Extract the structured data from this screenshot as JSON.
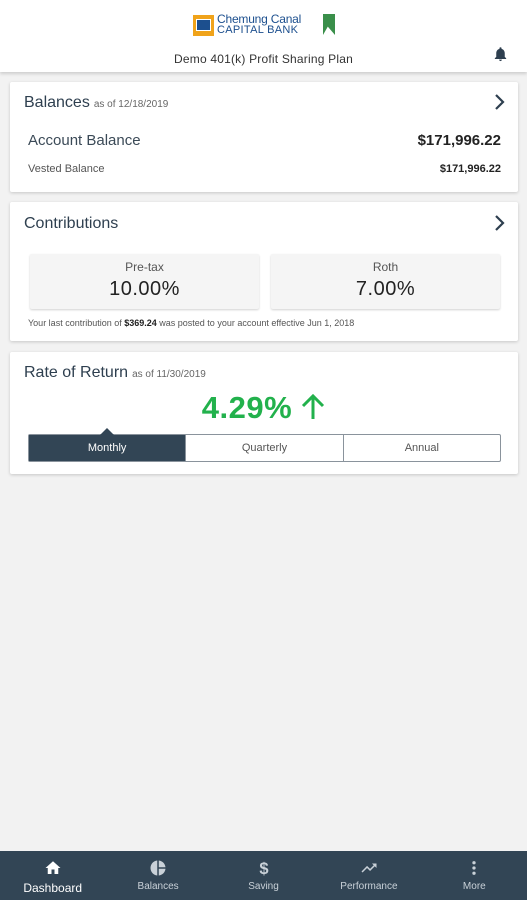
{
  "header": {
    "logo_line1": "Chemung Canal",
    "logo_line2": "CAPITAL BANK",
    "plan_name": "Demo 401(k) Profit Sharing Plan"
  },
  "balances": {
    "title": "Balances",
    "as_of": "as of 12/18/2019",
    "account_label": "Account Balance",
    "account_value": "$171,996.22",
    "vested_label": "Vested Balance",
    "vested_value": "$171,996.22"
  },
  "contributions": {
    "title": "Contributions",
    "pretax_label": "Pre-tax",
    "pretax_value": "10.00%",
    "roth_label": "Roth",
    "roth_value": "7.00%",
    "note_prefix": "Your last contribution of ",
    "note_amount": "$369.24",
    "note_suffix": " was posted to your account effective Jun 1, 2018"
  },
  "rate_of_return": {
    "title": "Rate of Return",
    "as_of": "as of 11/30/2019",
    "value": "4.29%",
    "tabs": [
      "Monthly",
      "Quarterly",
      "Annual"
    ],
    "selected_tab": "Monthly",
    "positive_color": "#22b14c"
  },
  "nav": {
    "items": [
      "Dashboard",
      "Balances",
      "Saving",
      "Performance",
      "More"
    ],
    "active": "Dashboard"
  },
  "icons": {
    "bell": "bell-icon",
    "chevron": "chevron-right-icon",
    "arrow_up": "arrow-up-icon",
    "home": "home-icon",
    "pie": "pie-chart-icon",
    "dollar": "dollar-icon",
    "trend": "trending-up-icon",
    "more": "more-vertical-icon"
  }
}
